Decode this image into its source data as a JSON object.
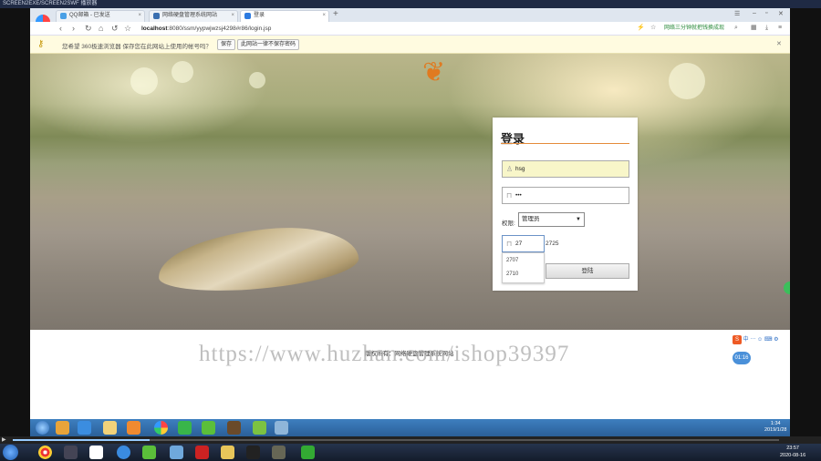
{
  "player": {
    "title": "SCREEN2EXE/SCREEN2SWF 播放器"
  },
  "tabs": [
    {
      "label": "QQ邮箱 - 已发送",
      "color": "#4aa0e6"
    },
    {
      "label": "网络硬盘管理系统网站",
      "color": "#3a6fb0"
    },
    {
      "label": "登录",
      "color": "#2d7be0"
    }
  ],
  "address": {
    "url_host": "localhost",
    "url_path": ":8080/ssm/yypwjwzsj4298#r86/login.jsp",
    "right_text": "网络三分钟就把钱换成现"
  },
  "password_bar": {
    "message": "您希望 360极速浏览器 保存您在此网站上使用的帐号吗？",
    "save_label": "保存",
    "never_label": "此网站一律不保存密码"
  },
  "login": {
    "title": "登录",
    "username": "hsg",
    "password": "•••",
    "role_label": "权限:",
    "role_value": "管理员",
    "code_value": "27",
    "captcha": "2725",
    "button_label": "登陆",
    "autocomplete": [
      "2707",
      "2710"
    ]
  },
  "footer": {
    "text": "版权所有：网络硬盘管理系统网站"
  },
  "watermark": "https://www.huzhan.com/ishop39397",
  "ime": {
    "label": "中"
  },
  "clock_bubble": "01:16",
  "inner_clock": {
    "time": "1:34",
    "date": "2019/1/28"
  },
  "host_clock": {
    "time": "23:57",
    "date": "2020-08-16"
  }
}
